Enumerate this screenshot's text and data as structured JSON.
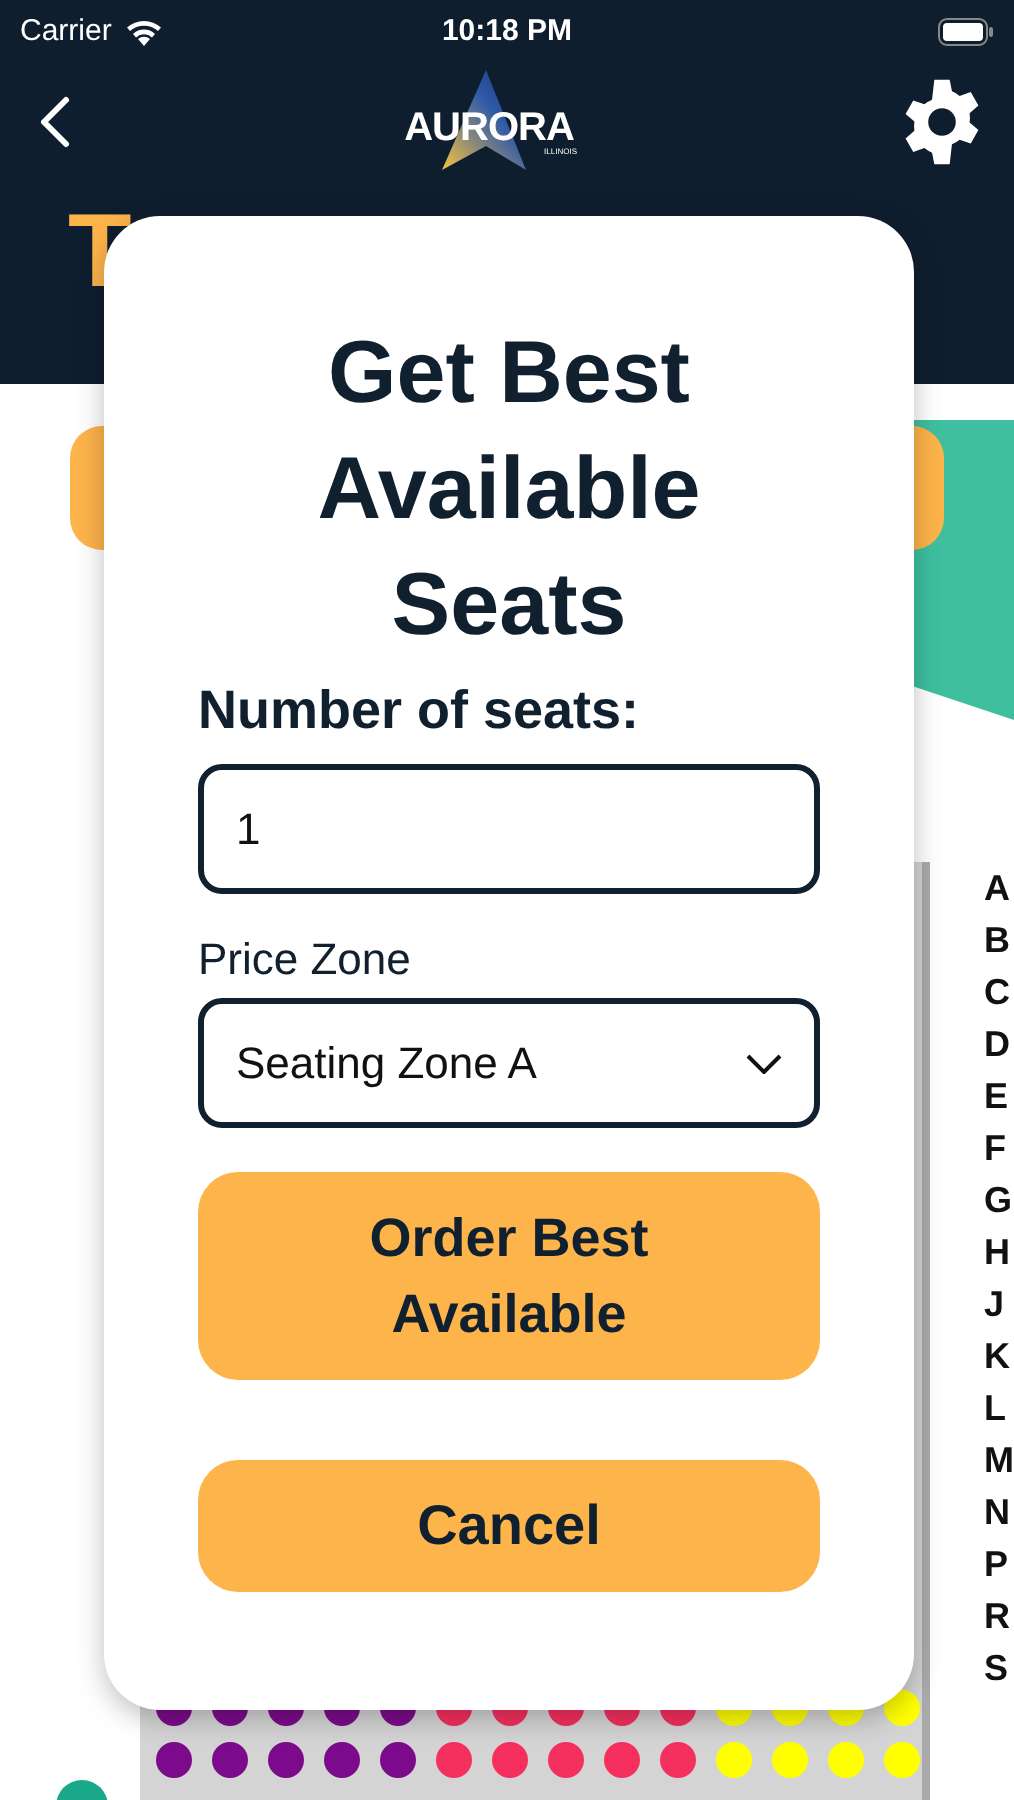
{
  "status_bar": {
    "carrier": "Carrier",
    "time": "10:18 PM"
  },
  "header": {
    "logo_text": "AURORA",
    "logo_subtext": "ILLINOIS"
  },
  "page": {
    "title": "T",
    "row_letters": [
      "A",
      "B",
      "C",
      "D",
      "E",
      "F",
      "G",
      "H",
      "J",
      "K",
      "L",
      "M",
      "N",
      "P",
      "R",
      "S"
    ]
  },
  "dialog": {
    "title": "Get Best Available Seats",
    "seats_label": "Number of seats:",
    "seats_value": "1",
    "zone_label": "Price Zone",
    "zone_value": "Seating Zone A",
    "buttons": [
      {
        "label": "Order Best Available",
        "kind": "primary"
      },
      {
        "label": "Cancel",
        "kind": "secondary"
      }
    ]
  }
}
